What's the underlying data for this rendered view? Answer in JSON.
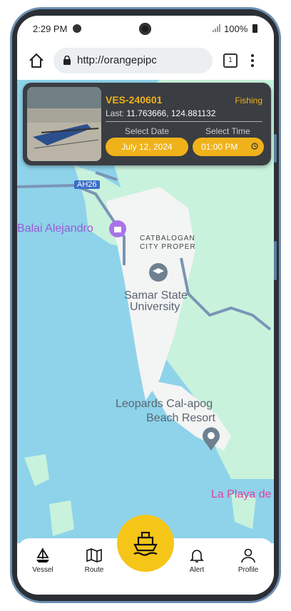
{
  "status_bar": {
    "time": "2:29 PM",
    "battery": "100%"
  },
  "browser": {
    "url": "http://orangepipc",
    "tab_count": "1"
  },
  "vessel_card": {
    "id": "VES-240601",
    "status": "Fishing",
    "last_label": "Last:",
    "last_coords": "11.763666, 124.881132",
    "select_date_label": "Select Date",
    "select_time_label": "Select Time",
    "date_value": "July 12, 2024",
    "time_value": "01:00  PM"
  },
  "map": {
    "labels": {
      "road": "AH26",
      "balai": "Balai Alejandro",
      "catbalogan_1": "CATBALOGAN",
      "catbalogan_2": "CITY PROPER",
      "samar_1": "Samar State",
      "samar_2": "University",
      "leopards_1": "Leopards Cal-apog",
      "leopards_2": "Beach Resort",
      "playa": "La Playa de"
    }
  },
  "bottom_nav": {
    "items": [
      {
        "label": "Vessel"
      },
      {
        "label": "Route"
      },
      {
        "label": "Alert"
      },
      {
        "label": "Profile"
      }
    ]
  },
  "colors": {
    "accent": "#f0b21a",
    "card_bg": "#3a3d42",
    "water": "#8ed3ea",
    "land": "#c8f2dc",
    "fab": "#f5c518"
  }
}
